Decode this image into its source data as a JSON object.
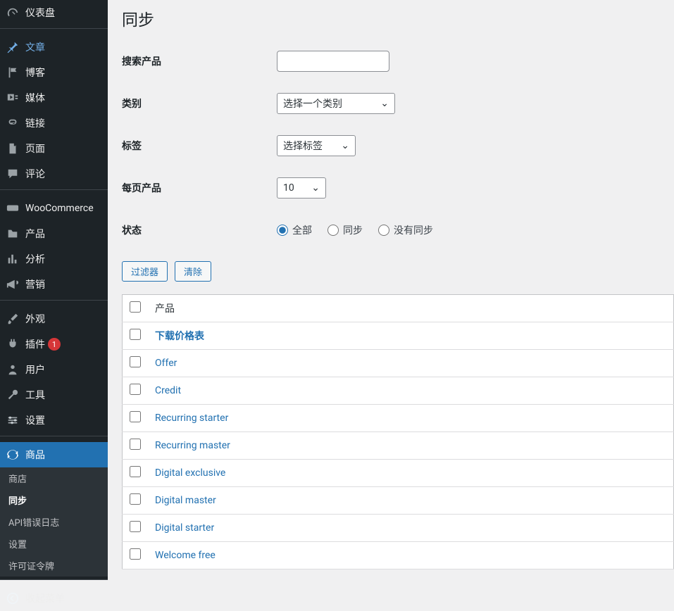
{
  "page": {
    "title": "同步"
  },
  "sidebar": {
    "items": [
      {
        "id": "dashboard",
        "label": "仪表盘",
        "icon": "gauge"
      },
      {
        "id": "posts",
        "label": "文章",
        "icon": "pin",
        "active_top": true
      },
      {
        "id": "blog",
        "label": "博客",
        "icon": "flag"
      },
      {
        "id": "media",
        "label": "媒体",
        "icon": "media"
      },
      {
        "id": "links",
        "label": "链接",
        "icon": "link"
      },
      {
        "id": "pages",
        "label": "页面",
        "icon": "page"
      },
      {
        "id": "comments",
        "label": "评论",
        "icon": "comment"
      },
      {
        "id": "woocommerce",
        "label": "WooCommerce",
        "icon": "woo"
      },
      {
        "id": "products",
        "label": "产品",
        "icon": "product"
      },
      {
        "id": "analytics",
        "label": "分析",
        "icon": "chart"
      },
      {
        "id": "marketing",
        "label": "营销",
        "icon": "megaphone"
      },
      {
        "id": "appearance",
        "label": "外观",
        "icon": "brush"
      },
      {
        "id": "plugins",
        "label": "插件",
        "icon": "plugin",
        "badge": "1"
      },
      {
        "id": "users",
        "label": "用户",
        "icon": "users"
      },
      {
        "id": "tools",
        "label": "工具",
        "icon": "wrench"
      },
      {
        "id": "settings",
        "label": "设置",
        "icon": "sliders"
      },
      {
        "id": "merchandise",
        "label": "商品",
        "icon": "refresh",
        "current": true
      }
    ],
    "submenu": [
      {
        "id": "store",
        "label": "商店"
      },
      {
        "id": "sync",
        "label": "同步",
        "active": true
      },
      {
        "id": "apilog",
        "label": "API错误日志"
      },
      {
        "id": "subsettings",
        "label": "设置"
      },
      {
        "id": "license",
        "label": "许可证令牌"
      }
    ],
    "collapse_label": "收起菜单"
  },
  "filters": {
    "search_label": "搜索产品",
    "search_value": "",
    "category_label": "类别",
    "category_value": "选择一个类别",
    "tag_label": "标签",
    "tag_value": "选择标签",
    "perpage_label": "每页产品",
    "perpage_value": "10",
    "status_label": "状态",
    "status_options": {
      "all": "全部",
      "sync": "同步",
      "nosync": "没有同步"
    },
    "status_selected": "all",
    "filter_btn": "过滤器",
    "clear_btn": "清除"
  },
  "table": {
    "header_product": "产品",
    "rows": [
      {
        "name": "下载价格表",
        "bold": true
      },
      {
        "name": "Offer"
      },
      {
        "name": "Credit"
      },
      {
        "name": "Recurring starter"
      },
      {
        "name": "Recurring master"
      },
      {
        "name": "Digital exclusive"
      },
      {
        "name": "Digital master"
      },
      {
        "name": "Digital starter"
      },
      {
        "name": "Welcome free"
      }
    ]
  }
}
